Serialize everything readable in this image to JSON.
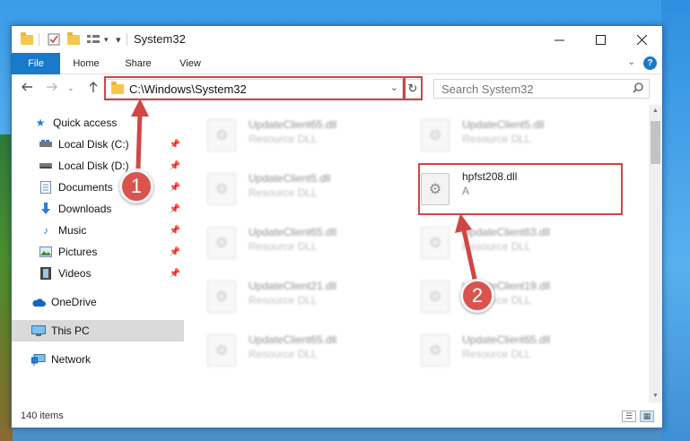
{
  "window": {
    "title": "System32",
    "qa_dropdown": "▾"
  },
  "ribbon": {
    "tabs": [
      "File",
      "Home",
      "Share",
      "View"
    ],
    "help": "?"
  },
  "nav": {
    "address": "C:\\Windows\\System32",
    "search_placeholder": "Search System32"
  },
  "sidebar": {
    "items": [
      {
        "label": "Quick access",
        "icon": "star-icon"
      },
      {
        "label": "Local Disk (C:)",
        "icon": "drive-icon"
      },
      {
        "label": "Local Disk (D:)",
        "icon": "drive-icon"
      },
      {
        "label": "Documents",
        "icon": "documents-icon"
      },
      {
        "label": "Downloads",
        "icon": "download-icon"
      },
      {
        "label": "Music",
        "icon": "music-icon"
      },
      {
        "label": "Pictures",
        "icon": "pictures-icon"
      },
      {
        "label": "Videos",
        "icon": "videos-icon"
      },
      {
        "label": "OneDrive",
        "icon": "cloud-icon"
      },
      {
        "label": "This PC",
        "icon": "computer-icon"
      },
      {
        "label": "Network",
        "icon": "network-icon"
      }
    ]
  },
  "files": [
    {
      "name": "UpdateClient65.dll",
      "type": "Resource DLL"
    },
    {
      "name": "UpdateClient5.dll",
      "type": "Resource DLL"
    },
    {
      "name": "UpdateClient5.dll",
      "type": "Resource DLL"
    },
    {
      "name": "hpfst208.dll",
      "type": "A"
    },
    {
      "name": "UpdateClient65.dll",
      "type": "Resource DLL"
    },
    {
      "name": "UpdateClient63.dll",
      "type": "Resource DLL"
    },
    {
      "name": "UpdateClient21.dll",
      "type": "Resource DLL"
    },
    {
      "name": "UpdateClient19.dll",
      "type": "Resource DLL"
    },
    {
      "name": "UpdateClient65.dll",
      "type": "Resource DLL"
    },
    {
      "name": "UpdateClient65.dll",
      "type": "Resource DLL"
    }
  ],
  "status": {
    "item_count": "140 items"
  },
  "annotations": {
    "step1": "1",
    "step2": "2",
    "color": "#d24545"
  }
}
